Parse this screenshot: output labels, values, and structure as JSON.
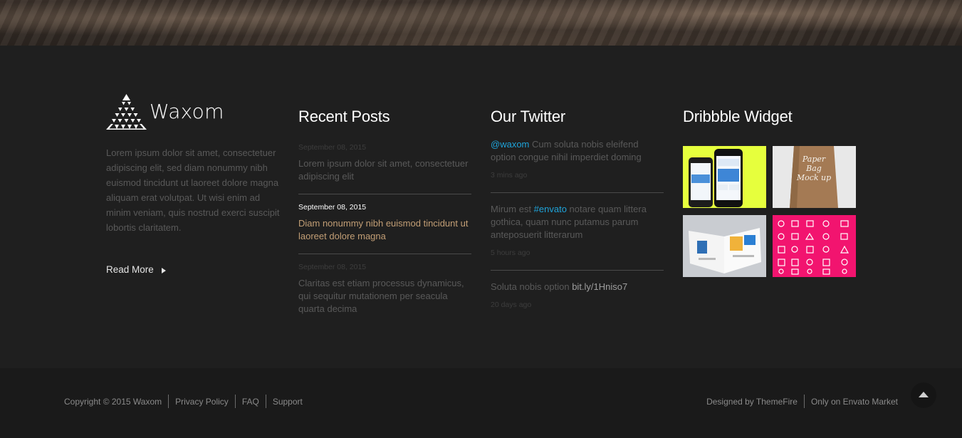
{
  "brand": {
    "name": "Waxom"
  },
  "about": {
    "text": "Lorem ipsum dolor sit amet, consectetuer adipiscing elit, sed diam nonummy nibh euismod tincidunt ut laoreet dolore magna aliquam erat volutpat. Ut wisi enim ad minim veniam, quis nostrud exerci suscipit lobortis claritatem.",
    "read_more": "Read More"
  },
  "recent_posts": {
    "title": "Recent Posts",
    "posts": [
      {
        "date": "September 08, 2015",
        "title": "Lorem ipsum dolor sit amet, consectetuer adipiscing elit"
      },
      {
        "date": "September 08, 2015",
        "title": "Diam nonummy nibh euismod tincidunt ut laoreet dolore magna"
      },
      {
        "date": "September 08, 2015",
        "title": "Claritas est etiam processus dynamicus, qui sequitur mutationem per seacula quarta decima"
      }
    ]
  },
  "twitter": {
    "title": "Our Twitter",
    "tweets": [
      {
        "handle": "@waxom",
        "text": " Cum soluta nobis eleifend option congue nihil imperdiet doming",
        "time": "3 mins ago"
      },
      {
        "pre": "Mirum est ",
        "tag": "#envato",
        "post": " notare quam littera gothica, quam nunc putamus parum anteposuerit litterarum",
        "time": "5 hours ago"
      },
      {
        "pre": "Soluta nobis option ",
        "link": "bit.ly/1Hniso7",
        "time": "20 days ago"
      }
    ]
  },
  "dribbble": {
    "title": "Dribbble Widget"
  },
  "bottom": {
    "copyright": "Copyright © 2015  Waxom",
    "links": [
      "Privacy Policy",
      "FAQ",
      "Support"
    ],
    "designed_by": "Designed by  ThemeFire",
    "market": "Only on  Envato Market"
  },
  "colors": {
    "accent_post": "#c29e75",
    "twitter_link": "#1fa3d9",
    "shot_pink": "#f2146f",
    "shot_lime": "#e6ff3d"
  }
}
